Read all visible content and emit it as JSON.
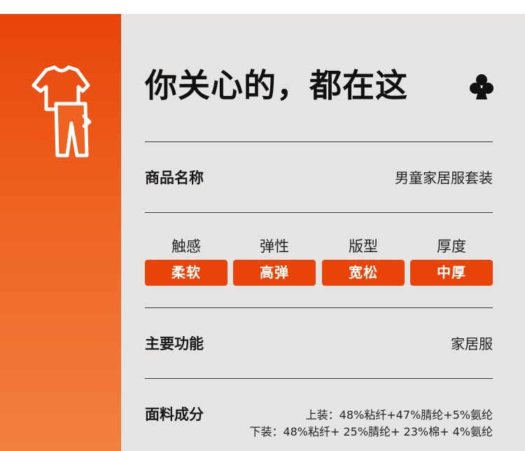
{
  "title": "你关心的，都在这",
  "product": {
    "label": "商品名称",
    "value": "男童家居服套装"
  },
  "attributes": [
    {
      "label": "触感",
      "value": "柔软"
    },
    {
      "label": "弹性",
      "value": "高弹"
    },
    {
      "label": "版型",
      "value": "宽松"
    },
    {
      "label": "厚度",
      "value": "中厚"
    }
  ],
  "function": {
    "label": "主要功能",
    "value": "家居服"
  },
  "fabric": {
    "label": "面料成分",
    "top": "上装：48%粘纤+47%腈纶+5%氨纶",
    "bottom": "下装：48%粘纤+ 25%腈纶+ 23%棉+ 4%氨纶"
  },
  "icons": {
    "sidebar": "clothing-set-icon",
    "title": "club-icon"
  },
  "colors": {
    "accent": "#e8440a",
    "panel": "#e6e4e3"
  }
}
